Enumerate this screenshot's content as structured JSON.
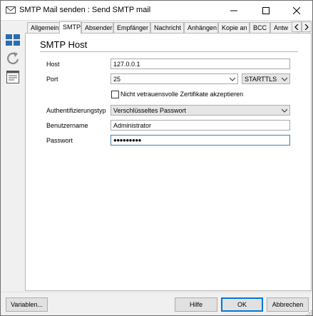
{
  "window": {
    "title": "SMTP Mail senden : Send SMTP mail"
  },
  "rail": {
    "icons": [
      "windows-tiles-icon",
      "refresh-icon",
      "form-view-icon"
    ]
  },
  "tabs": [
    {
      "label": "Allgemein",
      "active": false
    },
    {
      "label": "SMTP",
      "active": true
    },
    {
      "label": "Absender",
      "active": false
    },
    {
      "label": "Empfänger",
      "active": false
    },
    {
      "label": "Nachricht",
      "active": false
    },
    {
      "label": "Anhängen",
      "active": false
    },
    {
      "label": "Kopie an",
      "active": false
    },
    {
      "label": "BCC",
      "active": false
    },
    {
      "label": "Antw",
      "active": false
    }
  ],
  "section": {
    "title": "SMTP Host"
  },
  "form": {
    "host_label": "Host",
    "host_value": "127.0.0.1",
    "port_label": "Port",
    "port_value": "25",
    "security_value": "STARTTLS",
    "untrusted_cert_label": "Nicht vetrauensvolle Zertifikate akzeptieren",
    "untrusted_cert_checked": false,
    "auth_label": "Authentifizierungstyp",
    "auth_value": "Verschlüsseltes Passwort",
    "user_label": "Benutzername",
    "user_value": "Administrator",
    "password_label": "Passwort",
    "password_value": "●●●●●●●●●"
  },
  "footer": {
    "variables_label": "Variablen...",
    "help_label": "Hilfe",
    "ok_label": "OK",
    "cancel_label": "Abbrechen"
  },
  "colors": {
    "accent": "#0078d7",
    "focus_border": "#3c7fb1",
    "icon_blue": "#2b6cb0"
  }
}
